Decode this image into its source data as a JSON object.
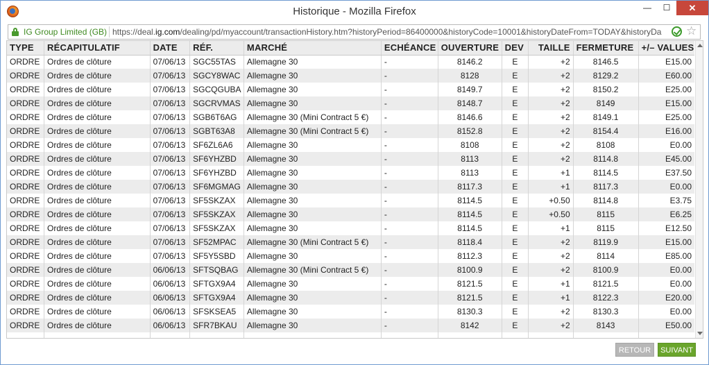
{
  "window": {
    "title": "Historique - Mozilla Firefox",
    "min_glyph": "—",
    "max_glyph": "☐",
    "close_glyph": "✕"
  },
  "addressbar": {
    "site_identity": "IG Group Limited (GB)",
    "url_prefix": "https://deal.",
    "url_domain": "ig.com",
    "url_rest": "/dealing/pd/myaccount/transactionHistory.htm?historyPeriod=86400000&historyCode=10001&historyDateFrom=TODAY&historyDa",
    "star_glyph": "☆"
  },
  "table": {
    "headers": [
      "TYPE",
      "RÉCAPITULATIF",
      "DATE",
      "RÉF.",
      "MARCHÉ",
      "ECHÉANCE",
      "OUVERTURE",
      "DEV",
      "TAILLE",
      "FERMETURE",
      "+/– VALUES"
    ],
    "rows": [
      [
        "ORDRE",
        "Ordres de clôture",
        "07/06/13",
        "SGC55TAS",
        "Allemagne 30",
        "-",
        "8146.2",
        "E",
        "+2",
        "8146.5",
        "E15.00"
      ],
      [
        "ORDRE",
        "Ordres de clôture",
        "07/06/13",
        "SGCY8WAC",
        "Allemagne 30",
        "-",
        "8128",
        "E",
        "+2",
        "8129.2",
        "E60.00"
      ],
      [
        "ORDRE",
        "Ordres de clôture",
        "07/06/13",
        "SGCQGUBA",
        "Allemagne 30",
        "-",
        "8149.7",
        "E",
        "+2",
        "8150.2",
        "E25.00"
      ],
      [
        "ORDRE",
        "Ordres de clôture",
        "07/06/13",
        "SGCRVMAS",
        "Allemagne 30",
        "-",
        "8148.7",
        "E",
        "+2",
        "8149",
        "E15.00"
      ],
      [
        "ORDRE",
        "Ordres de clôture",
        "07/06/13",
        "SGB6T6AG",
        "Allemagne 30 (Mini Contract 5 €)",
        "-",
        "8146.6",
        "E",
        "+2",
        "8149.1",
        "E25.00"
      ],
      [
        "ORDRE",
        "Ordres de clôture",
        "07/06/13",
        "SGBT63A8",
        "Allemagne 30 (Mini Contract 5 €)",
        "-",
        "8152.8",
        "E",
        "+2",
        "8154.4",
        "E16.00"
      ],
      [
        "ORDRE",
        "Ordres de clôture",
        "07/06/13",
        "SF6ZL6A6",
        "Allemagne 30",
        "-",
        "8108",
        "E",
        "+2",
        "8108",
        "E0.00"
      ],
      [
        "ORDRE",
        "Ordres de clôture",
        "07/06/13",
        "SF6YHZBD",
        "Allemagne 30",
        "-",
        "8113",
        "E",
        "+2",
        "8114.8",
        "E45.00"
      ],
      [
        "ORDRE",
        "Ordres de clôture",
        "07/06/13",
        "SF6YHZBD",
        "Allemagne 30",
        "-",
        "8113",
        "E",
        "+1",
        "8114.5",
        "E37.50"
      ],
      [
        "ORDRE",
        "Ordres de clôture",
        "07/06/13",
        "SF6MGMAG",
        "Allemagne 30",
        "-",
        "8117.3",
        "E",
        "+1",
        "8117.3",
        "E0.00"
      ],
      [
        "ORDRE",
        "Ordres de clôture",
        "07/06/13",
        "SF5SKZAX",
        "Allemagne 30",
        "-",
        "8114.5",
        "E",
        "+0.50",
        "8114.8",
        "E3.75"
      ],
      [
        "ORDRE",
        "Ordres de clôture",
        "07/06/13",
        "SF5SKZAX",
        "Allemagne 30",
        "-",
        "8114.5",
        "E",
        "+0.50",
        "8115",
        "E6.25"
      ],
      [
        "ORDRE",
        "Ordres de clôture",
        "07/06/13",
        "SF5SKZAX",
        "Allemagne 30",
        "-",
        "8114.5",
        "E",
        "+1",
        "8115",
        "E12.50"
      ],
      [
        "ORDRE",
        "Ordres de clôture",
        "07/06/13",
        "SF52MPAC",
        "Allemagne 30 (Mini Contract 5 €)",
        "-",
        "8118.4",
        "E",
        "+2",
        "8119.9",
        "E15.00"
      ],
      [
        "ORDRE",
        "Ordres de clôture",
        "07/06/13",
        "SF5Y5SBD",
        "Allemagne 30",
        "-",
        "8112.3",
        "E",
        "+2",
        "8114",
        "E85.00"
      ],
      [
        "ORDRE",
        "Ordres de clôture",
        "06/06/13",
        "SFTSQBAG",
        "Allemagne 30 (Mini Contract 5 €)",
        "-",
        "8100.9",
        "E",
        "+2",
        "8100.9",
        "E0.00"
      ],
      [
        "ORDRE",
        "Ordres de clôture",
        "06/06/13",
        "SFTGX9A4",
        "Allemagne 30",
        "-",
        "8121.5",
        "E",
        "+1",
        "8121.5",
        "E0.00"
      ],
      [
        "ORDRE",
        "Ordres de clôture",
        "06/06/13",
        "SFTGX9A4",
        "Allemagne 30",
        "-",
        "8121.5",
        "E",
        "+1",
        "8122.3",
        "E20.00"
      ],
      [
        "ORDRE",
        "Ordres de clôture",
        "06/06/13",
        "SFSKSEA5",
        "Allemagne 30",
        "-",
        "8130.3",
        "E",
        "+2",
        "8130.3",
        "E0.00"
      ],
      [
        "ORDRE",
        "Ordres de clôture",
        "06/06/13",
        "SFR7BKAU",
        "Allemagne 30",
        "-",
        "8142",
        "E",
        "+2",
        "8143",
        "E50.00"
      ]
    ]
  },
  "footer": {
    "retour_label": "RETOUR",
    "suivant_label": "SUIVANT"
  }
}
